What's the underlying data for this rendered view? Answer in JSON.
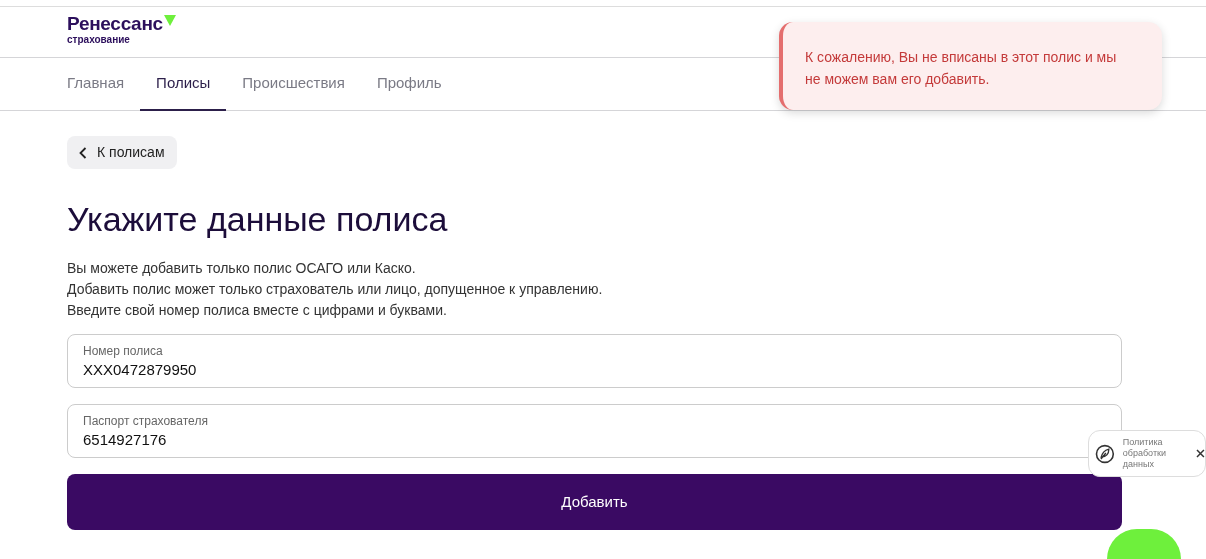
{
  "logo": {
    "name": "Ренессанс",
    "subtitle": "страхование"
  },
  "tabs": [
    {
      "label": "Главная",
      "selected": false
    },
    {
      "label": "Полисы",
      "selected": true
    },
    {
      "label": "Происшествия",
      "selected": false
    },
    {
      "label": "Профиль",
      "selected": false
    }
  ],
  "back_link": {
    "label": "К полисам"
  },
  "heading": "Укажите данные полиса",
  "description": [
    "Вы можете добавить только полис ОСАГО или Каско.",
    "Добавить полис может только страхователь или лицо, допущенное к управлению.",
    "Введите свой номер полиса вместе с цифрами и буквами."
  ],
  "fields": [
    {
      "label": "Номер полиса",
      "value": "XXX0472879950"
    },
    {
      "label": "Паспорт страхователя",
      "value": "6514927176"
    }
  ],
  "submit_button": "Добавить",
  "toast": {
    "kind": "error",
    "message": "К сожалению, Вы не вписаны в этот полис и мы не можем вам его добавить."
  },
  "policy_widget": {
    "text": "Политика обработки данных"
  }
}
